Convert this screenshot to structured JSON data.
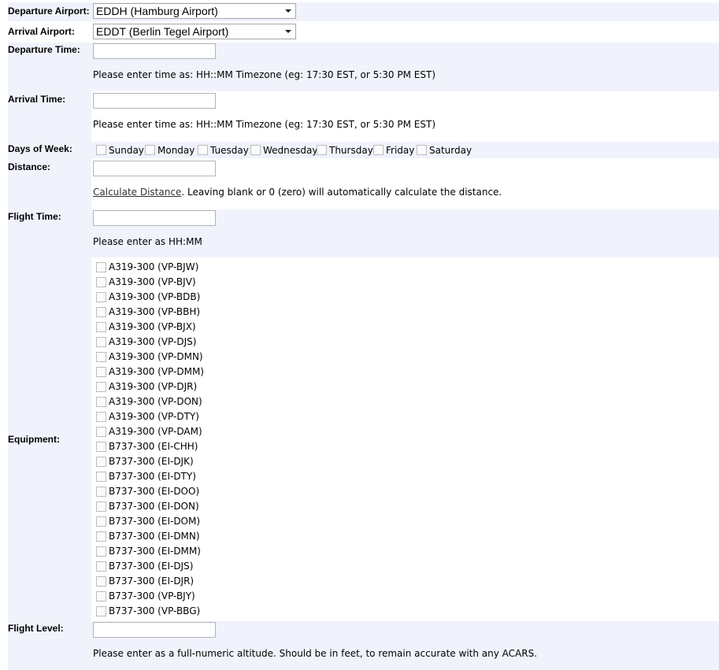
{
  "departure_airport": {
    "label": "Departure Airport:",
    "value": "EDDH (Hamburg Airport)"
  },
  "arrival_airport": {
    "label": "Arrival Airport:",
    "value": "EDDT (Berlin Tegel Airport)"
  },
  "departure_time": {
    "label": "Departure Time:",
    "value": "",
    "hint": "Please enter time as: HH::MM Timezone (eg: 17:30 EST, or 5:30 PM EST)"
  },
  "arrival_time": {
    "label": "Arrival Time:",
    "value": "",
    "hint": "Please enter time as: HH::MM Timezone (eg: 17:30 EST, or 5:30 PM EST)"
  },
  "days_of_week": {
    "label": "Days of Week:",
    "days": [
      "Sunday",
      "Monday",
      "Tuesday",
      "Wednesday",
      "Thursday",
      "Friday",
      "Saturday"
    ]
  },
  "distance": {
    "label": "Distance:",
    "value": "",
    "link_text": "Calculate Distance",
    "hint_rest": ". Leaving blank or 0 (zero) will automatically calculate the distance."
  },
  "flight_time": {
    "label": "Flight Time:",
    "value": "",
    "hint": "Please enter as HH:MM"
  },
  "equipment": {
    "label": "Equipment:",
    "items": [
      "A319-300 (VP-BJW)",
      "A319-300 (VP-BJV)",
      "A319-300 (VP-BDB)",
      "A319-300 (VP-BBH)",
      "A319-300 (VP-BJX)",
      "A319-300 (VP-DJS)",
      "A319-300 (VP-DMN)",
      "A319-300 (VP-DMM)",
      "A319-300 (VP-DJR)",
      "A319-300 (VP-DON)",
      "A319-300 (VP-DTY)",
      "A319-300 (VP-DAM)",
      "B737-300 (EI-CHH)",
      "B737-300 (EI-DJK)",
      "B737-300 (EI-DTY)",
      "B737-300 (EI-DOO)",
      "B737-300 (EI-DON)",
      "B737-300 (EI-DOM)",
      "B737-300 (EI-DMN)",
      "B737-300 (EI-DMM)",
      "B737-300 (EI-DJS)",
      "B737-300 (EI-DJR)",
      "B737-300 (VP-BJY)",
      "B737-300 (VP-BBG)"
    ]
  },
  "flight_level": {
    "label": "Flight Level:",
    "value": "",
    "hint": "Please enter as a full-numeric altitude. Should be in feet, to remain accurate with any ACARS."
  }
}
